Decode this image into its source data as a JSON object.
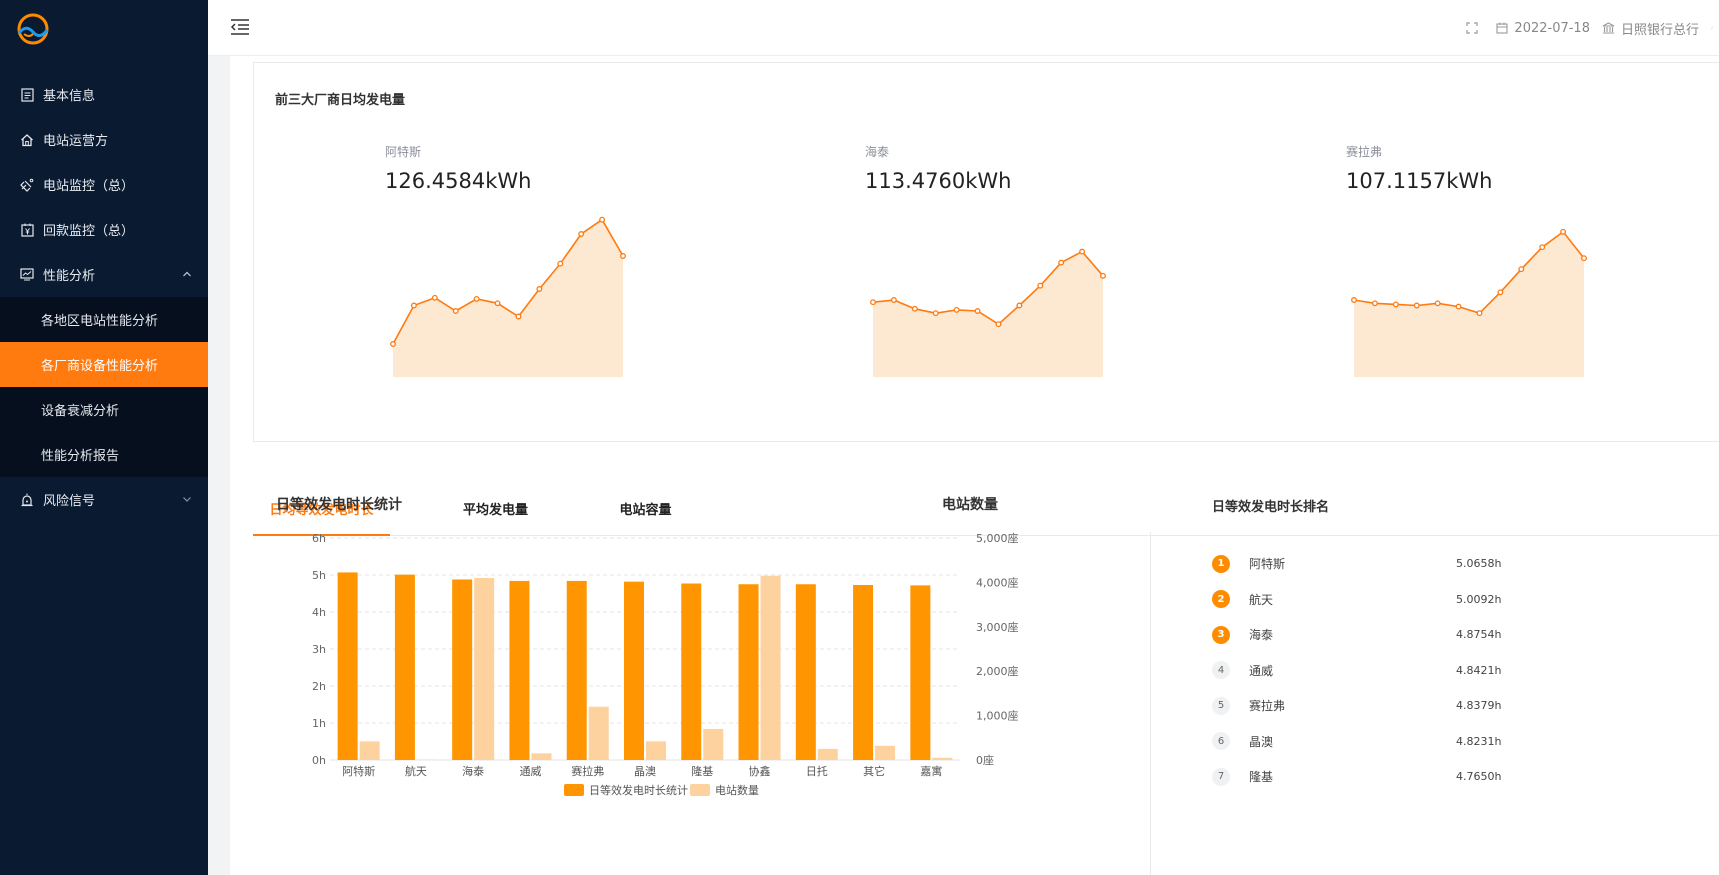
{
  "sidebar": {
    "menu": [
      {
        "label": "基本信息",
        "icon": "document-icon"
      },
      {
        "label": "电站运营方",
        "icon": "home-icon"
      },
      {
        "label": "电站监控（总）",
        "icon": "satellite-icon"
      },
      {
        "label": "回款监控（总）",
        "icon": "calendar-yen-icon"
      },
      {
        "label": "性能分析",
        "icon": "monitor-chart-icon"
      },
      {
        "label": "风险信号",
        "icon": "alarm-icon"
      }
    ],
    "submenu": [
      {
        "label": "各地区电站性能分析"
      },
      {
        "label": "各厂商设备性能分析"
      },
      {
        "label": "设备衰减分析"
      },
      {
        "label": "性能分析报告"
      }
    ],
    "active_submenu": "各厂商设备性能分析"
  },
  "topbar": {
    "date": "2022-07-18",
    "bank": "日照银行总行"
  },
  "top_panel": {
    "title": "前三大厂商日均发电量",
    "vendors": [
      {
        "name": "阿特斯",
        "value": "126.4584kWh"
      },
      {
        "name": "海泰",
        "value": "113.4760kWh"
      },
      {
        "name": "赛拉弗",
        "value": "107.1157kWh"
      }
    ]
  },
  "tabs": [
    {
      "label": "日均等效发电时长",
      "active": true
    },
    {
      "label": "平均发电量",
      "active": false
    },
    {
      "label": "电站容量",
      "active": false
    }
  ],
  "bar_panel": {
    "title": "日等效发电时长统计",
    "title_right": "电站数量"
  },
  "ranking": {
    "title": "日等效发电时长排名",
    "items": [
      {
        "rank": "1",
        "name": "阿特斯",
        "value": "5.0658h"
      },
      {
        "rank": "2",
        "name": "航天",
        "value": "5.0092h"
      },
      {
        "rank": "3",
        "name": "海泰",
        "value": "4.8754h"
      },
      {
        "rank": "4",
        "name": "通威",
        "value": "4.8421h"
      },
      {
        "rank": "5",
        "name": "赛拉弗",
        "value": "4.8379h"
      },
      {
        "rank": "6",
        "name": "晶澳",
        "value": "4.8231h"
      },
      {
        "rank": "7",
        "name": "隆基",
        "value": "4.7650h"
      }
    ]
  },
  "colors": {
    "accent": "#ff7a0f",
    "bar_primary": "#ff9500",
    "bar_secondary": "#fdd29e",
    "sparkline_fill": "#fde8d2",
    "sidebar_bg": "#0a1a30"
  },
  "chart_data": [
    {
      "type": "area",
      "series": [
        {
          "name": "阿特斯",
          "values": [
            0.3,
            0.65,
            0.72,
            0.6,
            0.71,
            0.67,
            0.55,
            0.8,
            1.03,
            1.3,
            1.43,
            1.1
          ]
        }
      ]
    },
    {
      "type": "area",
      "series": [
        {
          "name": "海泰",
          "values": [
            0.68,
            0.7,
            0.62,
            0.58,
            0.61,
            0.6,
            0.48,
            0.65,
            0.83,
            1.04,
            1.14,
            0.92
          ]
        }
      ]
    },
    {
      "type": "area",
      "series": [
        {
          "name": "赛拉弗",
          "values": [
            0.7,
            0.67,
            0.66,
            0.65,
            0.67,
            0.64,
            0.58,
            0.77,
            0.98,
            1.18,
            1.32,
            1.08
          ]
        }
      ]
    },
    {
      "type": "bar",
      "categories": [
        "阿特斯",
        "航天",
        "海泰",
        "通威",
        "赛拉弗",
        "晶澳",
        "隆基",
        "协鑫",
        "日托",
        "其它",
        "嘉寓"
      ],
      "series": [
        {
          "name": "日等效发电时长统计",
          "axis": "left",
          "values": [
            5.07,
            5.01,
            4.88,
            4.84,
            4.84,
            4.82,
            4.77,
            4.75,
            4.75,
            4.73,
            4.72
          ]
        },
        {
          "name": "电站数量",
          "axis": "right",
          "values": [
            420,
            10,
            4100,
            150,
            1200,
            420,
            700,
            4150,
            250,
            320,
            50
          ]
        }
      ],
      "y_left": {
        "ticks": [
          "0h",
          "1h",
          "2h",
          "3h",
          "4h",
          "5h",
          "6h"
        ],
        "max": 6
      },
      "y_right": {
        "ticks": [
          "0座",
          "1,000座",
          "2,000座",
          "3,000座",
          "4,000座",
          "5,000座"
        ],
        "max": 5000
      },
      "legend": "bottom-center"
    }
  ]
}
